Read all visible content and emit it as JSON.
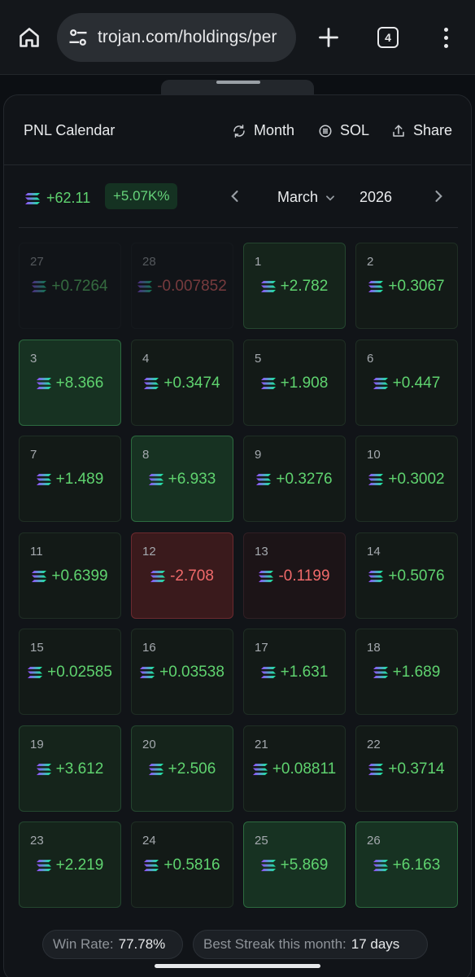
{
  "browser": {
    "url": "trojan.com/holdings/per",
    "tab_count": "4"
  },
  "panel": {
    "title": "PNL Calendar",
    "actions": {
      "month": "Month",
      "sol": "SOL",
      "share": "Share"
    }
  },
  "summary": {
    "sol_total": "+62.11",
    "percent": "+5.07K%",
    "month": "March",
    "year": "2026"
  },
  "calendar": {
    "cells": [
      {
        "day": "27",
        "value": "+0.7264",
        "tone": "faded",
        "dir": "up"
      },
      {
        "day": "28",
        "value": "-0.007852",
        "tone": "faded",
        "dir": "down"
      },
      {
        "day": "1",
        "value": "+2.782",
        "tone": "pos-2",
        "dir": "up"
      },
      {
        "day": "2",
        "value": "+0.3067",
        "tone": "pos-1",
        "dir": "up"
      },
      {
        "day": "3",
        "value": "+8.366",
        "tone": "pos-3",
        "dir": "up"
      },
      {
        "day": "4",
        "value": "+0.3474",
        "tone": "pos-1",
        "dir": "up"
      },
      {
        "day": "5",
        "value": "+1.908",
        "tone": "pos-1",
        "dir": "up"
      },
      {
        "day": "6",
        "value": "+0.447",
        "tone": "pos-1",
        "dir": "up"
      },
      {
        "day": "7",
        "value": "+1.489",
        "tone": "pos-1",
        "dir": "up"
      },
      {
        "day": "8",
        "value": "+6.933",
        "tone": "pos-3",
        "dir": "up"
      },
      {
        "day": "9",
        "value": "+0.3276",
        "tone": "pos-1",
        "dir": "up"
      },
      {
        "day": "10",
        "value": "+0.3002",
        "tone": "pos-1",
        "dir": "up"
      },
      {
        "day": "11",
        "value": "+0.6399",
        "tone": "pos-1",
        "dir": "up"
      },
      {
        "day": "12",
        "value": "-2.708",
        "tone": "neg-2",
        "dir": "down"
      },
      {
        "day": "13",
        "value": "-0.1199",
        "tone": "neg-1",
        "dir": "down"
      },
      {
        "day": "14",
        "value": "+0.5076",
        "tone": "pos-1",
        "dir": "up"
      },
      {
        "day": "15",
        "value": "+0.02585",
        "tone": "pos-1",
        "dir": "up"
      },
      {
        "day": "16",
        "value": "+0.03538",
        "tone": "pos-1",
        "dir": "up"
      },
      {
        "day": "17",
        "value": "+1.631",
        "tone": "pos-1",
        "dir": "up"
      },
      {
        "day": "18",
        "value": "+1.689",
        "tone": "pos-1",
        "dir": "up"
      },
      {
        "day": "19",
        "value": "+3.612",
        "tone": "pos-2",
        "dir": "up"
      },
      {
        "day": "20",
        "value": "+2.506",
        "tone": "pos-2",
        "dir": "up"
      },
      {
        "day": "21",
        "value": "+0.08811",
        "tone": "pos-1",
        "dir": "up"
      },
      {
        "day": "22",
        "value": "+0.3714",
        "tone": "pos-1",
        "dir": "up"
      },
      {
        "day": "23",
        "value": "+2.219",
        "tone": "pos-2",
        "dir": "up"
      },
      {
        "day": "24",
        "value": "+0.5816",
        "tone": "pos-1",
        "dir": "up"
      },
      {
        "day": "25",
        "value": "+5.869",
        "tone": "pos-3",
        "dir": "up"
      },
      {
        "day": "26",
        "value": "+6.163",
        "tone": "pos-3",
        "dir": "up"
      }
    ]
  },
  "stats": {
    "win_rate_label": "Win Rate:",
    "win_rate_value": "77.78%",
    "streak_label": "Best Streak this month:",
    "streak_value": "17 days"
  },
  "colors": {
    "positive": "#5fd36f",
    "negative": "#f06a6a",
    "background": "#111418"
  },
  "icons": [
    "home-icon",
    "site-settings-icon",
    "plus-icon",
    "tabs-icon",
    "more-vert-icon",
    "refresh-icon",
    "sol-coin-icon",
    "share-icon",
    "chevron-left-icon",
    "chevron-down-icon",
    "chevron-right-icon",
    "solana-logo-icon"
  ]
}
